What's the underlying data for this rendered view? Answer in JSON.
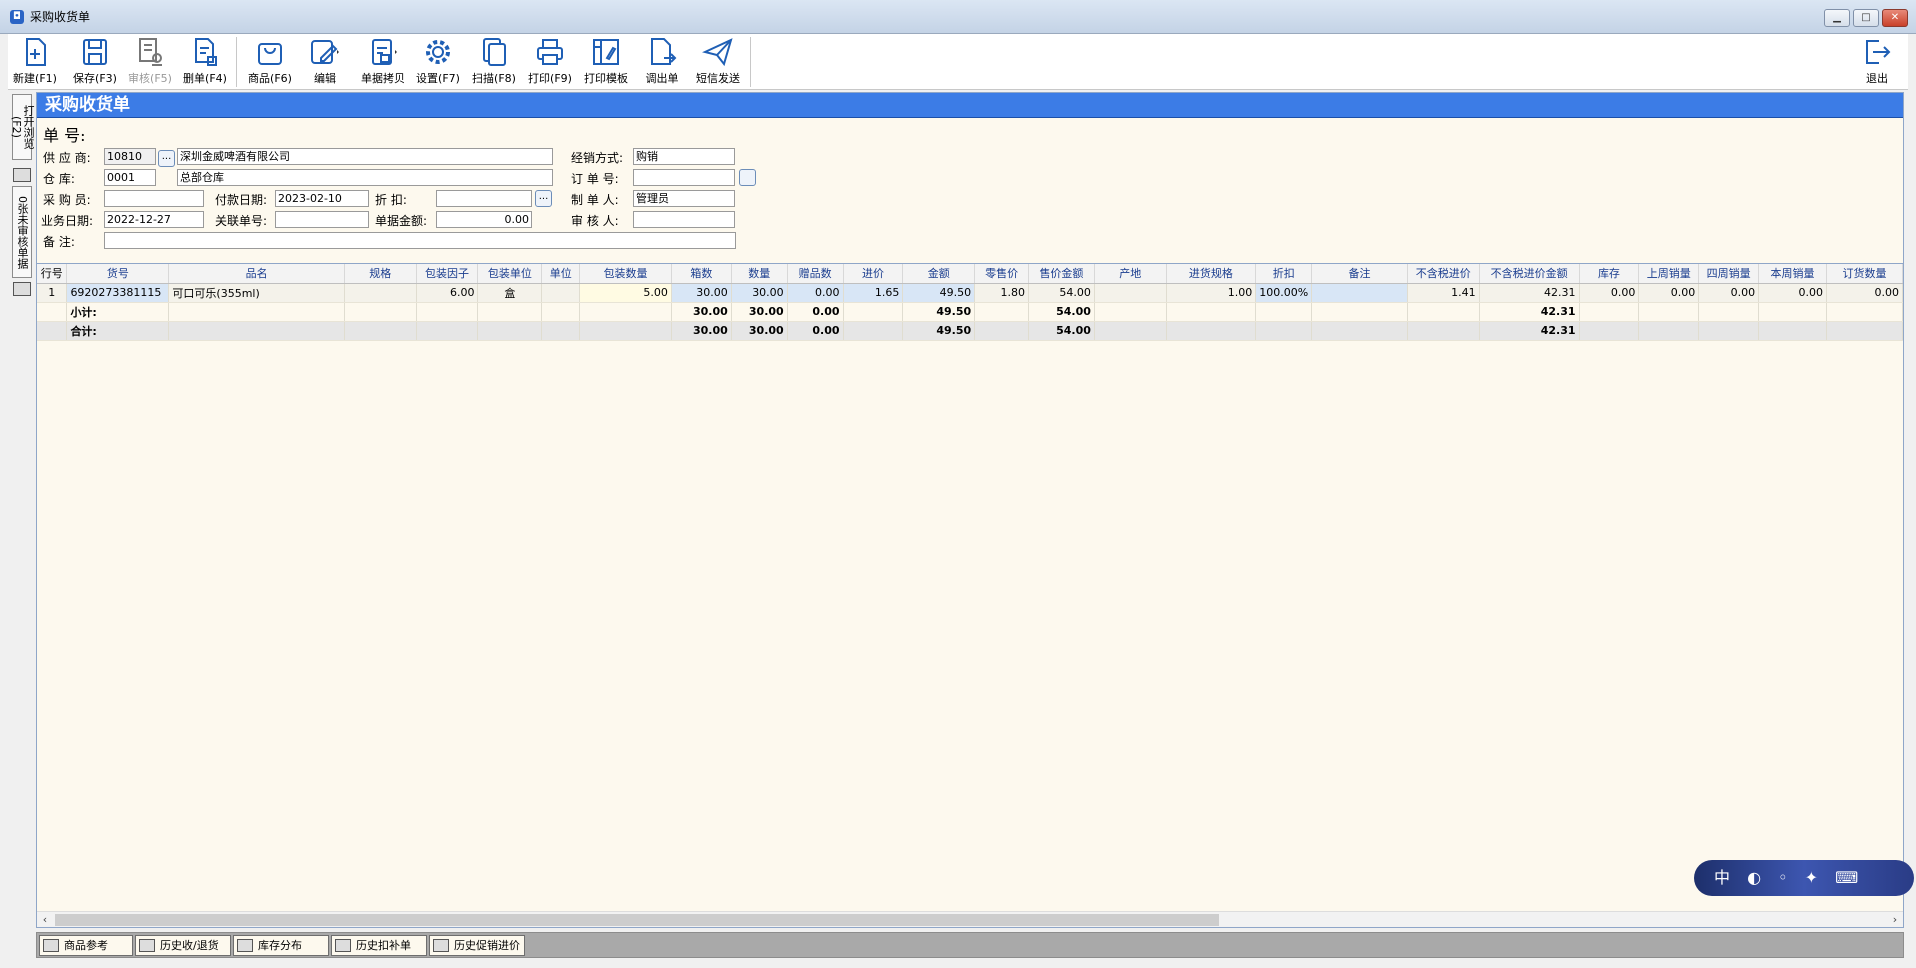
{
  "window": {
    "title": "采购收货单",
    "controls": [
      "▁",
      "□",
      "✕"
    ]
  },
  "toolbar": {
    "new": "新建(F1)",
    "save": "保存(F3)",
    "audit": "审核(F5)",
    "delete": "删单(F4)",
    "goods": "商品(F6)",
    "edit": "编辑",
    "copy": "单据拷贝",
    "settings": "设置(F7)",
    "scan": "扫描(F8)",
    "print": "打印(F9)",
    "print_template": "打印模板",
    "load": "调出单",
    "sms": "短信发送",
    "exit": "退出"
  },
  "side": {
    "open_browse": "打开浏览(F2)",
    "unaudited": "0张未审核单据"
  },
  "form": {
    "header": "采购收货单",
    "doc_no_label": "单  号:",
    "supplier_label": "供 应 商:",
    "supplier_code": "10810",
    "supplier_name": "深圳金威啤酒有限公司",
    "sales_mode_label": "经销方式:",
    "sales_mode": "购销",
    "warehouse_label": "仓    库:",
    "warehouse_code": "0001",
    "warehouse_name": "总部仓库",
    "order_no_label": "订 单 号:",
    "order_no": "",
    "buyer_label": "采 购 员:",
    "buyer": "",
    "pay_date_label": "付款日期:",
    "pay_date": "2023-02-10",
    "discount_label": "折    扣:",
    "discount": "",
    "maker_label": "制 单 人:",
    "maker": "管理员",
    "biz_date_label": "业务日期:",
    "biz_date": "2022-12-27",
    "related_no_label": "关联单号:",
    "related_no": "",
    "amount_label": "单据金额:",
    "amount": "0.00",
    "auditor_label": "审 核 人:",
    "auditor": "",
    "remark_label": "备    注:",
    "remark": "",
    "dots": "..."
  },
  "grid": {
    "columns": [
      "行号",
      "货号",
      "品名",
      "规格",
      "包装因子",
      "包装单位",
      "单位",
      "包装数量",
      "箱数",
      "数量",
      "赠品数",
      "进价",
      "金额",
      "零售价",
      "售价金额",
      "产地",
      "进货规格",
      "折扣",
      "备注",
      "不含税进价",
      "不含税进价金额",
      "库存",
      "上周销量",
      "四周销量",
      "本周销量",
      "订货数量"
    ],
    "rows": [
      [
        "1",
        "6920273381115",
        "可口可乐(355ml)",
        "",
        "6.00",
        "盒",
        "",
        "5.00",
        "30.00",
        "30.00",
        "0.00",
        "1.65",
        "49.50",
        "1.80",
        "54.00",
        "",
        "1.00",
        "100.00%",
        "",
        "1.41",
        "42.31",
        "0.00",
        "0.00",
        "0.00",
        "0.00",
        "0.00"
      ]
    ],
    "subtotal": [
      "",
      "小计:",
      "",
      "",
      "",
      "",
      "",
      "",
      "30.00",
      "30.00",
      "0.00",
      "",
      "49.50",
      "",
      "54.00",
      "",
      "",
      "",
      "",
      "",
      "42.31",
      "",
      "",
      "",
      "",
      ""
    ],
    "total": [
      "",
      "合计:",
      "",
      "",
      "",
      "",
      "",
      "",
      "30.00",
      "30.00",
      "0.00",
      "",
      "49.50",
      "",
      "54.00",
      "",
      "",
      "",
      "",
      "",
      "42.31",
      "",
      "",
      "",
      "",
      ""
    ]
  },
  "bottom_tabs": [
    "商品参考",
    "历史收/退货",
    "库存分布",
    "历史扣补单",
    "历史促销进价"
  ],
  "scroll": {
    "left": "‹",
    "right": "›"
  },
  "ime_badge": "中 ◐ ◦ ✦ ⌨"
}
